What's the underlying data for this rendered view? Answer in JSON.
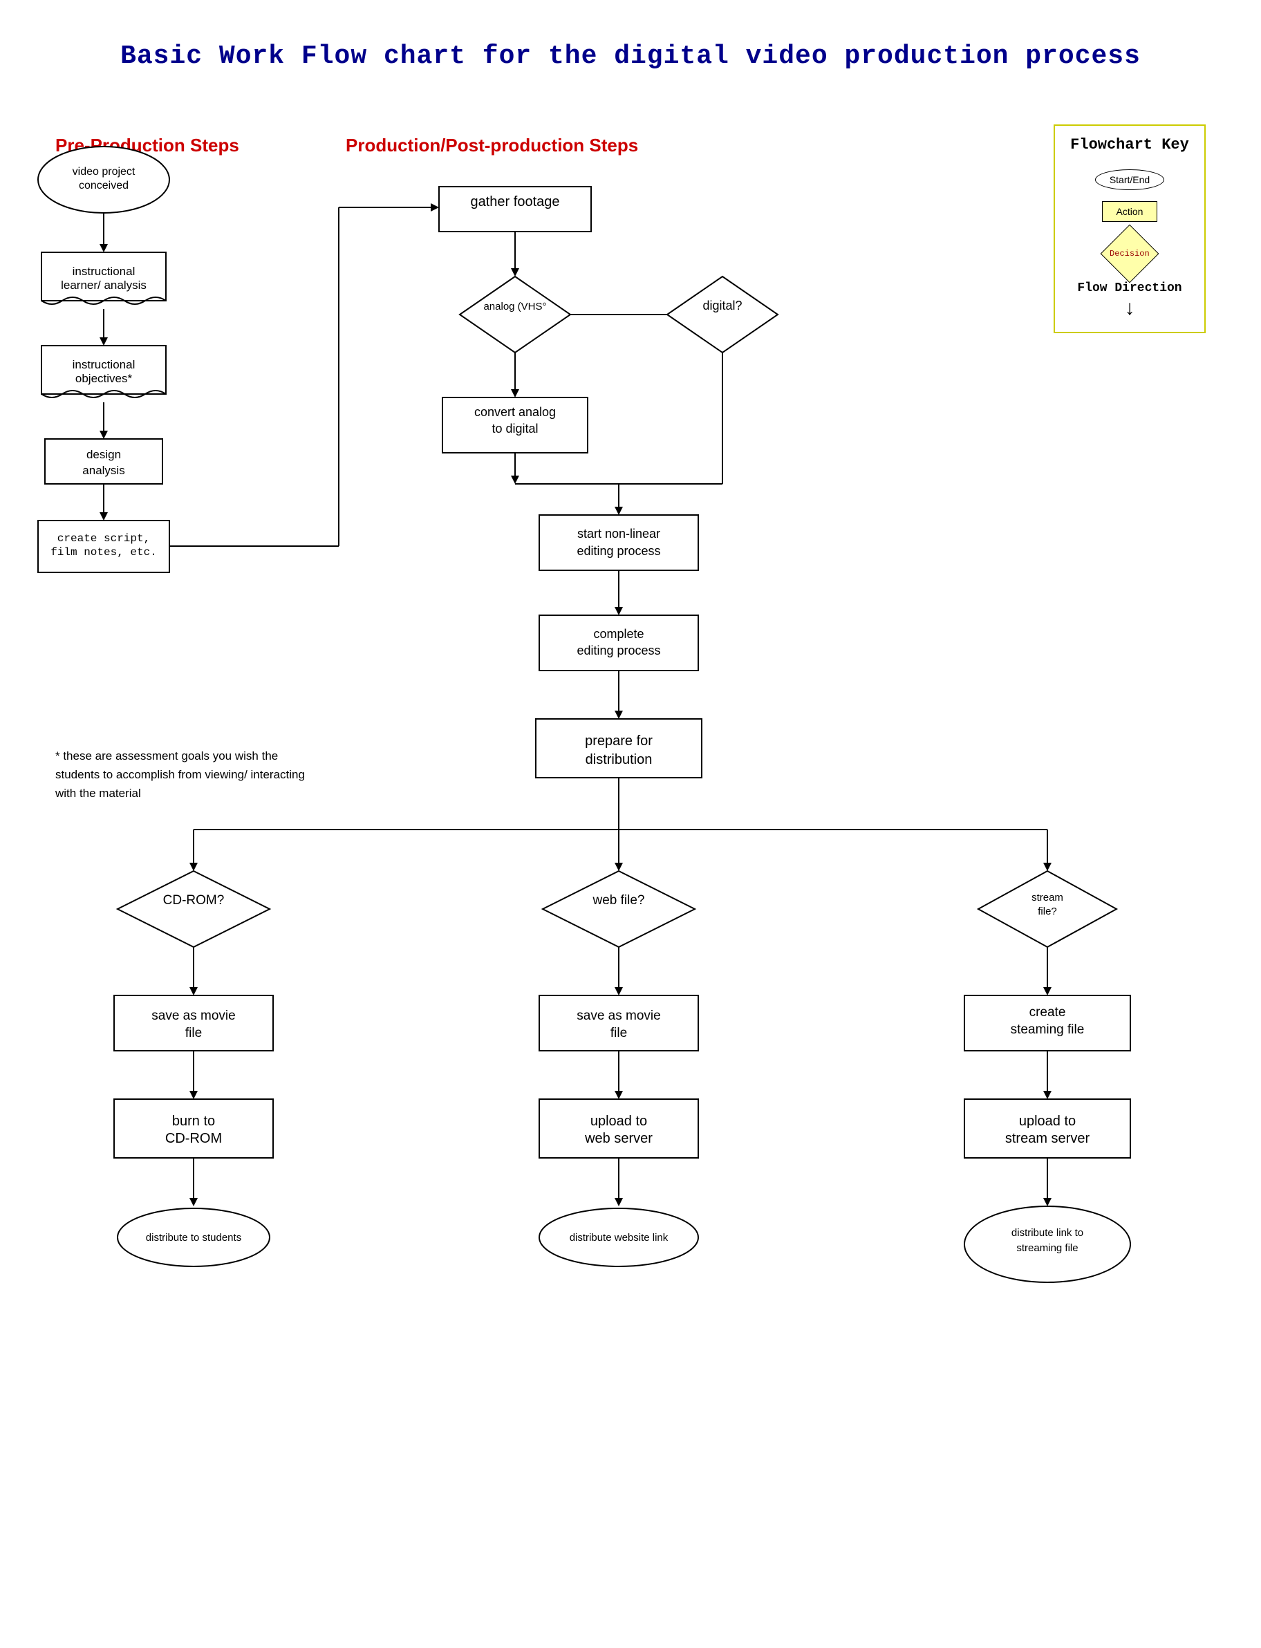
{
  "title": "Basic Work Flow chart for the digital video production process",
  "sections": {
    "pre_production": "Pre-Production Steps",
    "production": "Production/Post-production Steps"
  },
  "flowchart_key": {
    "title": "Flowchart Key",
    "start_end_label": "Start/End",
    "action_label": "Action",
    "decision_label": "Decision",
    "flow_direction_label": "Flow Direction"
  },
  "nodes": {
    "video_project": "video project\nconceived",
    "instructional_learner": "instructional\nlearner/ analysis",
    "instructional_objectives": "instructional\nobjectives*",
    "design_analysis": "design\nanalysis",
    "create_script": "create script,\nfilm notes, etc.",
    "gather_footage": "gather footage",
    "analog_decision": "analog (VHS°",
    "digital_decision": "digital?",
    "convert_analog": "convert analog\nto digital",
    "start_nonlinear": "start non-linear\nediting process",
    "complete_editing": "complete\nediting process",
    "prepare_distribution": "prepare for\ndistribution",
    "cdrom_decision": "CD-ROM?",
    "web_decision": "web file?",
    "stream_decision": "stream\nfile?",
    "save_movie_cdrom": "save as movie\nfile",
    "save_movie_web": "save as movie\nfile",
    "create_streaming": "create\nsteaming file",
    "burn_cdrom": "burn to\nCD-ROM",
    "upload_web": "upload to\nweb server",
    "upload_stream": "upload to\nstream server",
    "distribute_students": "distribute to students",
    "distribute_website": "distribute website link",
    "distribute_streaming": "distribute link to\nstreaming file"
  },
  "footnote": "* these are assessment goals you wish the\nstudents to accomplish from viewing/ interacting\nwith the material"
}
